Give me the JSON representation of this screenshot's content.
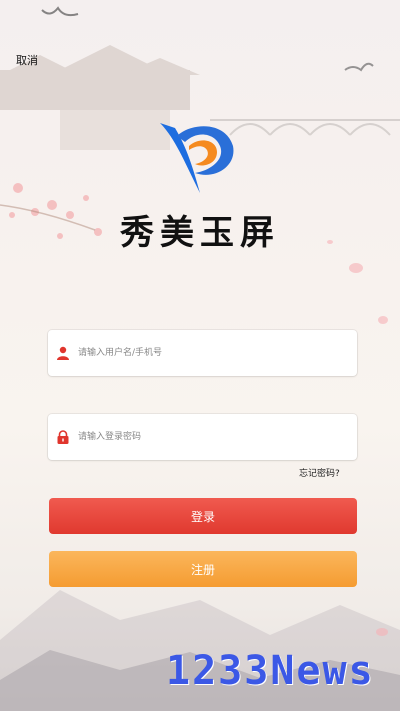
{
  "header": {
    "cancel_label": "取消"
  },
  "brand": {
    "title": "秀美玉屏"
  },
  "form": {
    "username_placeholder": "请输入用户名/手机号",
    "password_placeholder": "请输入登录密码",
    "forgot_label": "忘记密码?"
  },
  "buttons": {
    "login_label": "登录",
    "register_label": "注册"
  },
  "watermark": {
    "text": "1233News"
  },
  "colors": {
    "login_button": "#e8473d",
    "register_button": "#f7a640",
    "logo_blue": "#1e6ee0",
    "logo_orange": "#f58a1f",
    "watermark": "#3b58e6"
  },
  "icons": {
    "user": "user-icon",
    "lock": "lock-icon"
  }
}
